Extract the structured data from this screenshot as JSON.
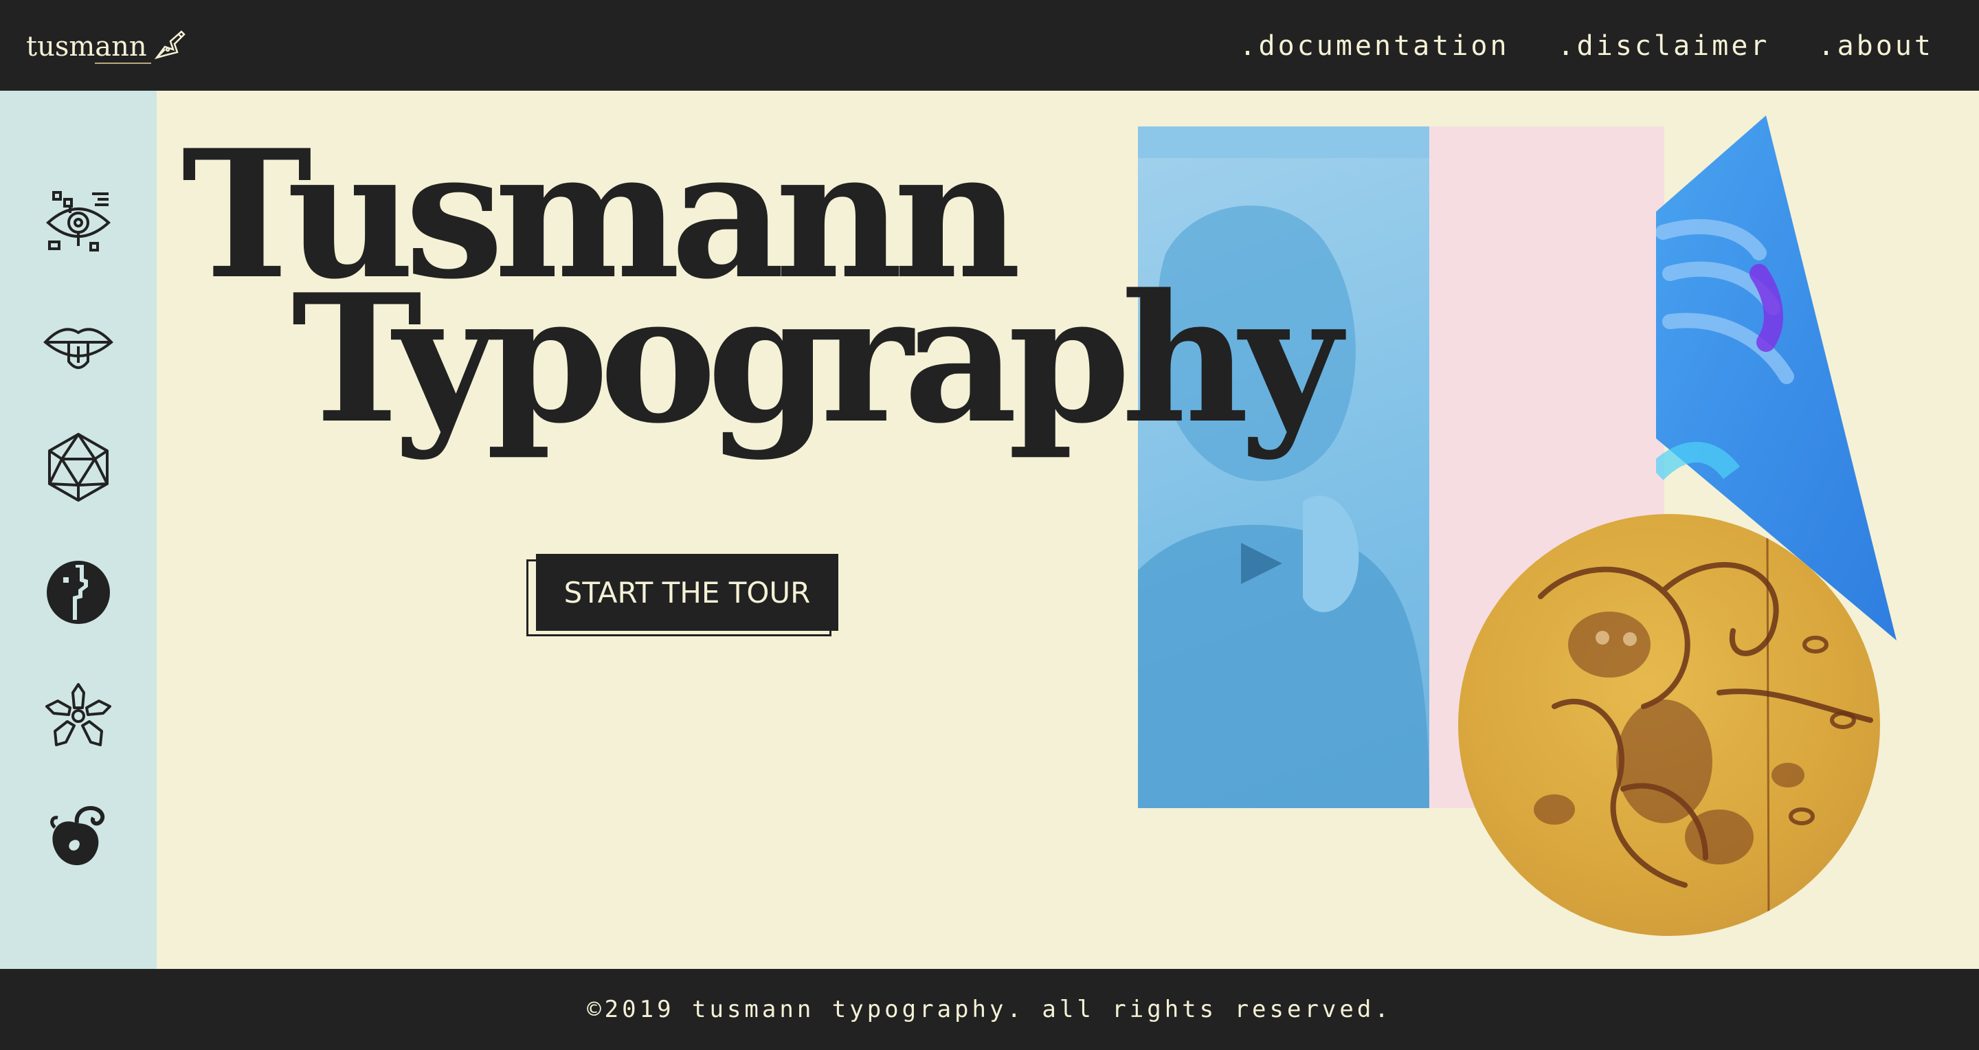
{
  "brand": {
    "name": "tusmann",
    "icon": "fountain-pen-icon"
  },
  "nav": {
    "documentation": ".documentation",
    "disclaimer": ".disclaimer",
    "about": ".about"
  },
  "sidebar": {
    "icons": [
      "eye-circuit-icon",
      "tongue-lips-icon",
      "icosahedron-icon",
      "face-profile-icon",
      "sakura-flower-icon",
      "fruit-swirl-icon"
    ]
  },
  "hero": {
    "title_line1": "Tusmann",
    "title_line2": "Typography",
    "cta_label": "START THE TOUR"
  },
  "footer": {
    "copyright": "©2019 tusmann typography. all rights reserved."
  },
  "colors": {
    "dark": "#222222",
    "cream": "#f4f1d6",
    "sidebar": "#cfe6e4",
    "pink": "#f6dde2",
    "photo_blue": "#7dbfe6",
    "triangle_blue": "#3b8fe8",
    "gold": "#d9a73d"
  }
}
